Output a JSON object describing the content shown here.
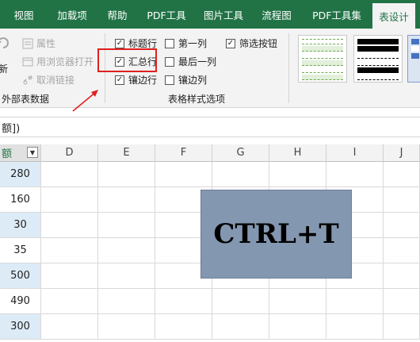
{
  "tabs": [
    {
      "label": "视图",
      "active": false
    },
    {
      "label": "加载项",
      "active": false
    },
    {
      "label": "帮助",
      "active": false
    },
    {
      "label": "PDF工具",
      "active": false
    },
    {
      "label": "图片工具",
      "active": false
    },
    {
      "label": "流程图",
      "active": false
    },
    {
      "label": "PDF工具集",
      "active": false
    },
    {
      "label": "表设计",
      "active": true
    }
  ],
  "external_data": {
    "properties": "属性",
    "open_in_browser": "用浏览器打开",
    "unlink": "取消链接",
    "refresh_partial": "新",
    "group_label": "外部表数据"
  },
  "style_options": {
    "header_row": {
      "label": "标题行",
      "checked": true
    },
    "total_row": {
      "label": "汇总行",
      "checked": true
    },
    "banded_rows": {
      "label": "镶边行",
      "checked": true
    },
    "first_column": {
      "label": "第一列",
      "checked": false
    },
    "last_column": {
      "label": "最后一列",
      "checked": false
    },
    "banded_columns": {
      "label": "镶边列",
      "checked": false
    },
    "filter_button": {
      "label": "筛选按钮",
      "checked": true
    },
    "group_label": "表格样式选项"
  },
  "formula_bar": {
    "text": "额])"
  },
  "grid": {
    "first_header": "额",
    "columns": [
      "D",
      "E",
      "F",
      "G",
      "H",
      "I",
      "J"
    ],
    "values": [
      "280",
      "160",
      "30",
      "35",
      "500",
      "490",
      "300"
    ]
  },
  "shape_text": "CTRL+T",
  "colors": {
    "accent": "#217346",
    "band": "#ddebf7",
    "shape": "#8497b0",
    "highlight": "#e02020"
  }
}
